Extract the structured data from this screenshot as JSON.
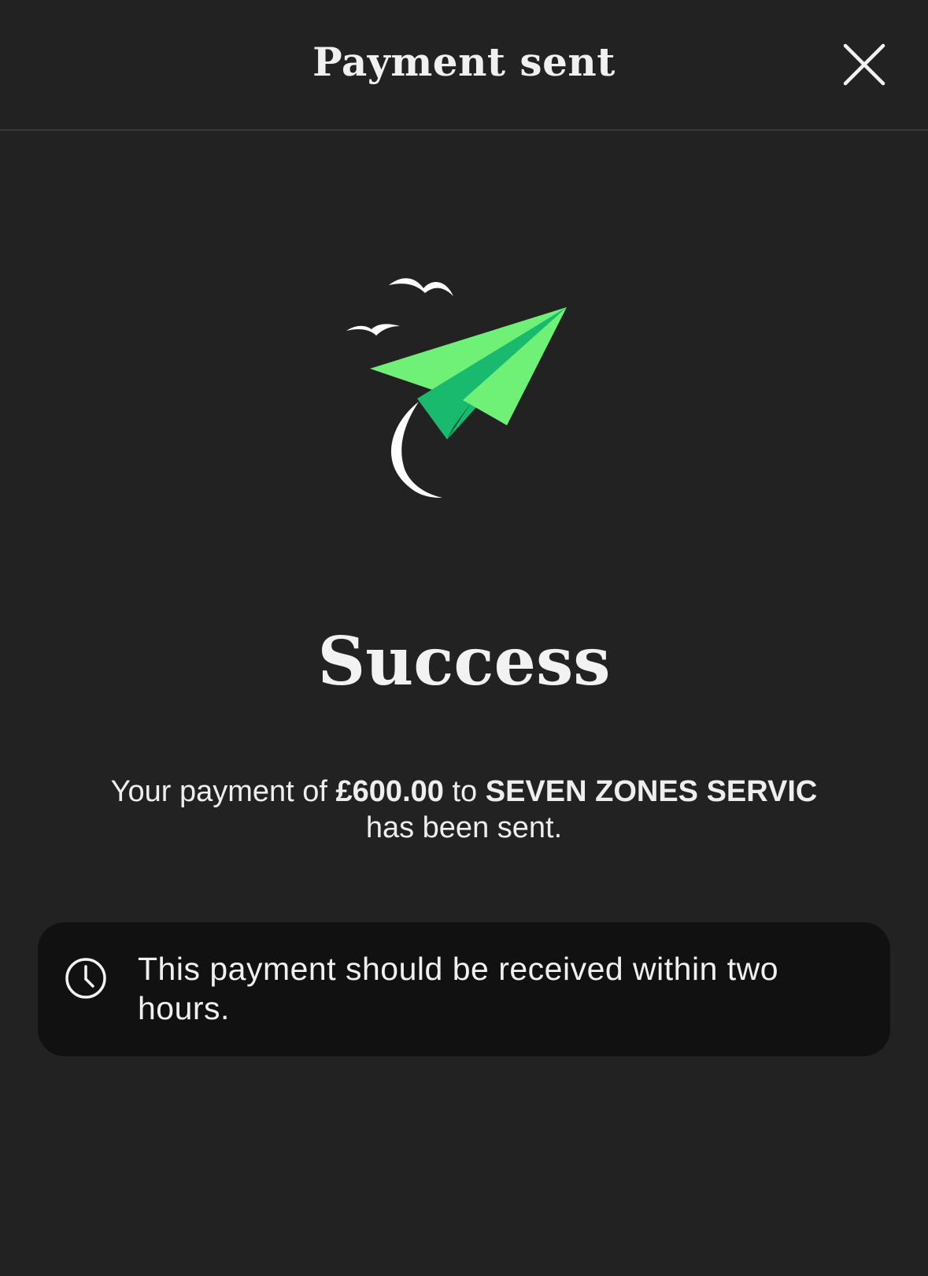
{
  "header": {
    "title": "Payment sent",
    "close_icon": "close-icon"
  },
  "hero": {
    "icon": "paper-plane-illustration",
    "colors": {
      "plane_light": "#6FF077",
      "plane_mid": "#19B96E",
      "plane_dark": "#0E4F36",
      "birds": "#FFFFFF"
    }
  },
  "status": {
    "title": "Success"
  },
  "message": {
    "prefix": "Your payment of ",
    "amount": "£600.00",
    "middle": " to ",
    "recipient": "SEVEN ZONES SERVIC",
    "suffix": "has been sent."
  },
  "info": {
    "icon": "clock-icon",
    "text": "This payment should be received within two hours."
  },
  "colors": {
    "background": "#222222",
    "card_background": "#111111",
    "text": "#EEEEEE",
    "accent_green": "#6FF077"
  }
}
